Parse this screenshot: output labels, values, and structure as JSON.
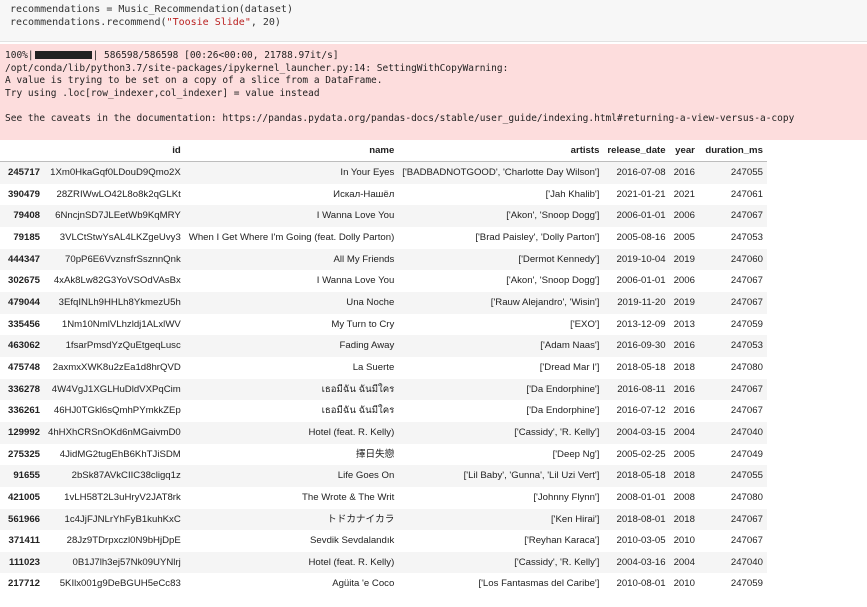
{
  "code_cell": {
    "line1": "recommendations = Music_Recommendation(dataset)",
    "line2_pre": "recommendations.recommend(",
    "line2_str": "\"Toosie Slide\"",
    "line2_post": ", 20)"
  },
  "stderr": {
    "progress_pct": "100%|",
    "progress_rest": "| 586598/586598 [00:26<00:00, 21788.97it/s]",
    "lines": [
      "/opt/conda/lib/python3.7/site-packages/ipykernel_launcher.py:14: SettingWithCopyWarning:",
      "A value is trying to be set on a copy of a slice from a DataFrame.",
      "Try using .loc[row_indexer,col_indexer] = value instead",
      "",
      "See the caveats in the documentation: https://pandas.pydata.org/pandas-docs/stable/user_guide/indexing.html#returning-a-view-versus-a-copy"
    ]
  },
  "table": {
    "columns": [
      "",
      "id",
      "name",
      "artists",
      "release_date",
      "year",
      "duration_ms"
    ],
    "rows": [
      [
        "245717",
        "1Xm0HkaGqf0LDouD9Qmo2X",
        "In Your Eyes",
        "['BADBADNOTGOOD', 'Charlotte Day Wilson']",
        "2016-07-08",
        "2016",
        "247055"
      ],
      [
        "390479",
        "28ZRIWwLO42L8o8k2qGLKt",
        "Искал-Нашёл",
        "['Jah Khalib']",
        "2021-01-21",
        "2021",
        "247061"
      ],
      [
        "79408",
        "6NncjnSD7JLEetWb9KqMRY",
        "I Wanna Love You",
        "['Akon', 'Snoop Dogg']",
        "2006-01-01",
        "2006",
        "247067"
      ],
      [
        "79185",
        "3VLCtStwYsAL4LKZgeUvy3",
        "When I Get Where I'm Going (feat. Dolly Parton)",
        "['Brad Paisley', 'Dolly Parton']",
        "2005-08-16",
        "2005",
        "247053"
      ],
      [
        "444347",
        "70pP6E6VvznsfrSsznnQnk",
        "All My Friends",
        "['Dermot Kennedy']",
        "2019-10-04",
        "2019",
        "247060"
      ],
      [
        "302675",
        "4xAk8Lw82G3YoVSOdVAsBx",
        "I Wanna Love You",
        "['Akon', 'Snoop Dogg']",
        "2006-01-01",
        "2006",
        "247067"
      ],
      [
        "479044",
        "3EfqINLh9HHLh8YkmezU5h",
        "Una Noche",
        "['Rauw Alejandro', 'Wisin']",
        "2019-11-20",
        "2019",
        "247067"
      ],
      [
        "335456",
        "1Nm10NmlVLhzldj1ALxlWV",
        "My Turn to Cry",
        "['EXO']",
        "2013-12-09",
        "2013",
        "247059"
      ],
      [
        "463062",
        "1fsarPmsdYzQuEtgeqLusc",
        "Fading Away",
        "['Adam Naas']",
        "2016-09-30",
        "2016",
        "247053"
      ],
      [
        "475748",
        "2axmxXWK8u2zEa1d8hrQVD",
        "La Suerte",
        "['Dread Mar I']",
        "2018-05-18",
        "2018",
        "247080"
      ],
      [
        "336278",
        "4W4VgJ1XGLHuDldVXPqCim",
        "เธอมีฉัน ฉันมีใคร",
        "['Da Endorphine']",
        "2016-08-11",
        "2016",
        "247067"
      ],
      [
        "336261",
        "46HJ0TGkl6sQmhPYmkkZEp",
        "เธอมีฉัน ฉันมีใคร",
        "['Da Endorphine']",
        "2016-07-12",
        "2016",
        "247067"
      ],
      [
        "129992",
        "4hHXhCRSnOKd6nMGaivmD0",
        "Hotel (feat. R. Kelly)",
        "['Cassidy', 'R. Kelly']",
        "2004-03-15",
        "2004",
        "247040"
      ],
      [
        "275325",
        "4JidMG2tugEhB6KhTJiSDM",
        "擇日失戀",
        "['Deep Ng']",
        "2005-02-25",
        "2005",
        "247049"
      ],
      [
        "91655",
        "2bSk87AVkCIIC38cligq1z",
        "Life Goes On",
        "['Lil Baby', 'Gunna', 'Lil Uzi Vert']",
        "2018-05-18",
        "2018",
        "247055"
      ],
      [
        "421005",
        "1vLH58T2L3uHryV2JAT8rk",
        "The Wrote & The Writ",
        "['Johnny Flynn']",
        "2008-01-01",
        "2008",
        "247080"
      ],
      [
        "561966",
        "1c4JjFJNLrYhFyB1kuhKxC",
        "トドカナイカラ",
        "['Ken Hirai']",
        "2018-08-01",
        "2018",
        "247067"
      ],
      [
        "371411",
        "28Jz9TDrpxczl0N9bHjDpE",
        "Sevdik Sevdalandık",
        "['Reyhan Karaca']",
        "2010-03-05",
        "2010",
        "247067"
      ],
      [
        "111023",
        "0B1J7lh3ej57Nk09UYNlrj",
        "Hotel (feat. R. Kelly)",
        "['Cassidy', 'R. Kelly']",
        "2004-03-16",
        "2004",
        "247040"
      ],
      [
        "217712",
        "5KIlx001g9DeBGUH5eCc83",
        "Agüita 'e Coco",
        "['Los Fantasmas del Caribe']",
        "2010-08-01",
        "2010",
        "247059"
      ]
    ]
  },
  "colors": {
    "stderr_bg": "#fddddd",
    "string_literal": "#ba2121",
    "row_stripe": "#f5f5f5"
  }
}
